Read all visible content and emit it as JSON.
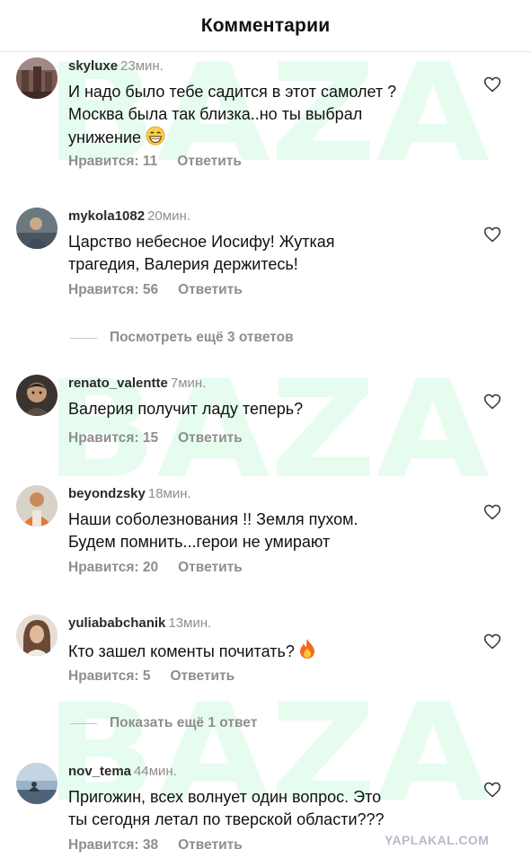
{
  "header": {
    "title": "Комментарии"
  },
  "watermark_text": "BAZA",
  "comments": [
    {
      "username": "skyluxe",
      "time": "23мин.",
      "text": "И надо было тебе садится в этот самолет ?\nМосква была так близка..но ты выбрал\nунижение",
      "emoji": "grinning-face",
      "likes": "Нравится: 11",
      "reply": "Ответить"
    },
    {
      "username": "mykola1082",
      "time": "20мин.",
      "text": "Царство небесное Иосифу! Жуткая\nтрагедия, Валерия держитесь!",
      "likes": "Нравится: 56",
      "reply": "Ответить"
    },
    {
      "username": "renato_valentte",
      "time": "7мин.",
      "text": "Валерия получит ладу теперь?",
      "likes": "Нравится: 15",
      "reply": "Ответить"
    },
    {
      "username": "beyondzsky",
      "time": "18мин.",
      "text": "Наши соболезнования !! Земля пухом.\nБудем помнить...герои не умирают",
      "likes": "Нравится: 20",
      "reply": "Ответить"
    },
    {
      "username": "yuliababchanik",
      "time": "13мин.",
      "text": "Кто зашел коменты почитать?",
      "emoji": "fire",
      "likes": "Нравится: 5",
      "reply": "Ответить"
    },
    {
      "username": "nov_tema",
      "time": "44мин.",
      "text": "Пригожин, всех волнует один вопрос. Это\nты сегодня летал по тверской области???",
      "likes": "Нравится: 38",
      "reply": "Ответить"
    }
  ],
  "view_more_replies_1": "Посмотреть ещё 3 ответов",
  "view_more_replies_2": "Показать ещё 1 ответ",
  "site_watermark": "YAPLAKAL.COM",
  "colors": {
    "text": "#111111",
    "muted": "#8e8e8e",
    "watermark_green": "#8ef0b4",
    "site_watermark": "#b5bcc8"
  },
  "icons": [
    "heart-outline-icon",
    "grinning-face-emoji",
    "fire-emoji"
  ]
}
